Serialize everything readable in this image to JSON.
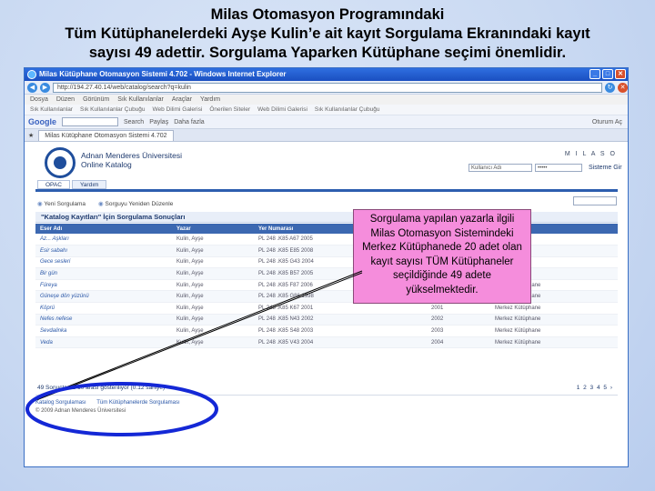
{
  "slide": {
    "title_lines": [
      "Milas Otomasyon Programındaki",
      "Tüm Kütüphanelerdeki Ayşe Kulin’e ait kayıt Sorgulama Ekranındaki kayıt",
      "sayısı 49 adettir. Sorgulama Yaparken Kütüphane seçimi önemlidir."
    ]
  },
  "browser": {
    "window_title": "Milas Kütüphane Otomasyon Sistemi 4.702 - Windows Internet Explorer",
    "address": "http://194.27.40.14/web/catalog/search?q=kulin",
    "menu": [
      "Dosya",
      "Düzen",
      "Görünüm",
      "Sık Kullanılanlar",
      "Araçlar",
      "Yardım"
    ],
    "favorites": [
      "Sık Kullanılanlar",
      "Sık Kullanılanlar Çubuğu",
      "Web Dilimi Galerisi",
      "Önerilen Siteler",
      "Web Dilimi Galerisi",
      "Sık Kullanılanlar Çubuğu"
    ],
    "google_label": "Google",
    "google_items": [
      "Search",
      "Paylaş",
      "Daha fazla",
      "Oturum Aç"
    ],
    "tab_title": "Milas Kütüphane Otomasyon Sistemi 4.702"
  },
  "page": {
    "university": "Adnan Menderes Üniversitesi",
    "subtitle": "Online Katalog",
    "brand": "M I L A S O",
    "login_placeholder": "Kullanıcı Adı",
    "password_mask": "•••••",
    "login_label": "Sisteme Gir",
    "tabs": [
      "OPAC",
      "Yardım"
    ],
    "crumbs": [
      "Yeni Sorgulama",
      "Sorguyu Yeniden Düzenle"
    ],
    "results_title": "\"Katalog Kayıtları\" İçin Sorgulama Sonuçları",
    "columns": [
      "Eser Adı",
      "Yazar",
      "Yer Numarası",
      "",
      ""
    ],
    "rows": [
      [
        "Az... Aşkları",
        "Kulin, Ayşe",
        "PL 248 .K85 A67 2005",
        "",
        ""
      ],
      [
        "Esir sabahı",
        "Kulin, Ayşe",
        "PL 248 .K85 E85 2008",
        "",
        ""
      ],
      [
        "Gece sesleri",
        "Kulin, Ayşe",
        "PL 248 .K85 G43 2004",
        "",
        ""
      ],
      [
        "Bir gün",
        "Kulin, Ayşe",
        "PL 248 .K85 B57 2005",
        "",
        ""
      ],
      [
        "Füreya",
        "Kulin, Ayşe",
        "PL 248 .K85 F87 2006",
        "2006",
        "Merkez Kütüphane"
      ],
      [
        "Güneşe dön yüzünü",
        "Kulin, Ayşe",
        "PL 248 .K85 G86 1998",
        "1998",
        "Merkez Kütüphane"
      ],
      [
        "Köprü",
        "Kulin, Ayşe",
        "PL 248 .K85 K67 2001",
        "2001",
        "Merkez Kütüphane"
      ],
      [
        "Nefes nefese",
        "Kulin, Ayşe",
        "PL 248 .K85 N43 2002",
        "2002",
        "Merkez Kütüphane"
      ],
      [
        "Sevdalinka",
        "Kulin, Ayşe",
        "PL 248 .K85 S48 2003",
        "2003",
        "Merkez Kütüphane"
      ],
      [
        "Veda",
        "Kulin, Ayşe",
        "PL 248 .K85 V43 2004",
        "2004",
        "Merkez Kütüphane"
      ]
    ],
    "count_text": "49 Sonuçtan 1-10 arası gösteriliyor (0.12 saniye)",
    "pagination": "1 2 3 4 5 ›",
    "footer_links": [
      "Katalog Sorgulaması",
      "Tüm Kütüphanelerde Sorgulaması"
    ],
    "footer_copyright": "© 2009 Adnan Menderes Üniversitesi"
  },
  "callout": {
    "lines": [
      "Sorgulama yapılan yazarla ilgili",
      "Milas Otomasyon Sistemindeki",
      "Merkez Kütüphanede 20 adet  olan",
      "kayıt sayısı TÜM  Kütüphaneler",
      "seçildiğinde  49 adete",
      "yükselmektedir."
    ],
    "color": "#f58ddc"
  },
  "annotation": {
    "ellipse_color": "#1428d6"
  }
}
